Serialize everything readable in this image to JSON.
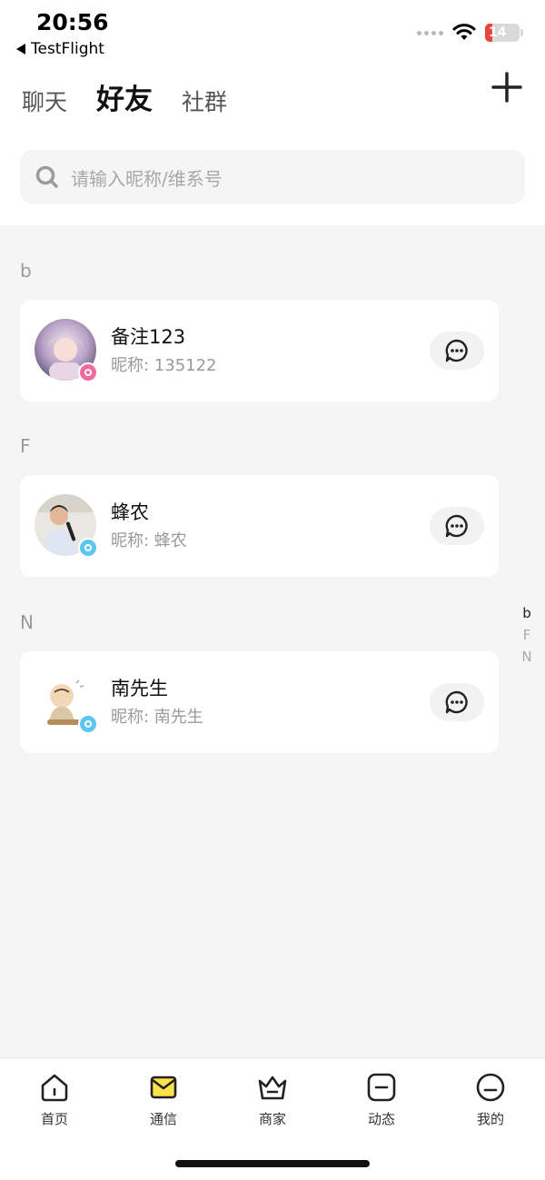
{
  "status_bar": {
    "time": "20:56",
    "back_app": "TestFlight",
    "battery": "14"
  },
  "tabs": [
    {
      "label": "聊天",
      "active": false
    },
    {
      "label": "好友",
      "active": true
    },
    {
      "label": "社群",
      "active": false
    }
  ],
  "search": {
    "placeholder": "请输入昵称/维系号"
  },
  "sections": [
    {
      "letter": "b",
      "contacts": [
        {
          "name": "备注123",
          "nickname": "昵称: 135122",
          "badge_color": "#f06aa0"
        }
      ]
    },
    {
      "letter": "F",
      "contacts": [
        {
          "name": "蜂农",
          "nickname": "昵称: 蜂农",
          "badge_color": "#5bc6f0"
        }
      ]
    },
    {
      "letter": "N",
      "contacts": [
        {
          "name": "南先生",
          "nickname": "昵称: 南先生",
          "badge_color": "#5bc6f0"
        }
      ]
    }
  ],
  "index_bar": [
    "b",
    "F",
    "N"
  ],
  "bottom_nav": [
    {
      "label": "首页",
      "icon": "home-icon"
    },
    {
      "label": "通信",
      "icon": "mail-icon",
      "active": true
    },
    {
      "label": "商家",
      "icon": "crown-icon"
    },
    {
      "label": "动态",
      "icon": "square-minus-icon"
    },
    {
      "label": "我的",
      "icon": "face-icon"
    }
  ],
  "colors": {
    "accent": "#fde24b",
    "background": "#f5f5f5"
  }
}
